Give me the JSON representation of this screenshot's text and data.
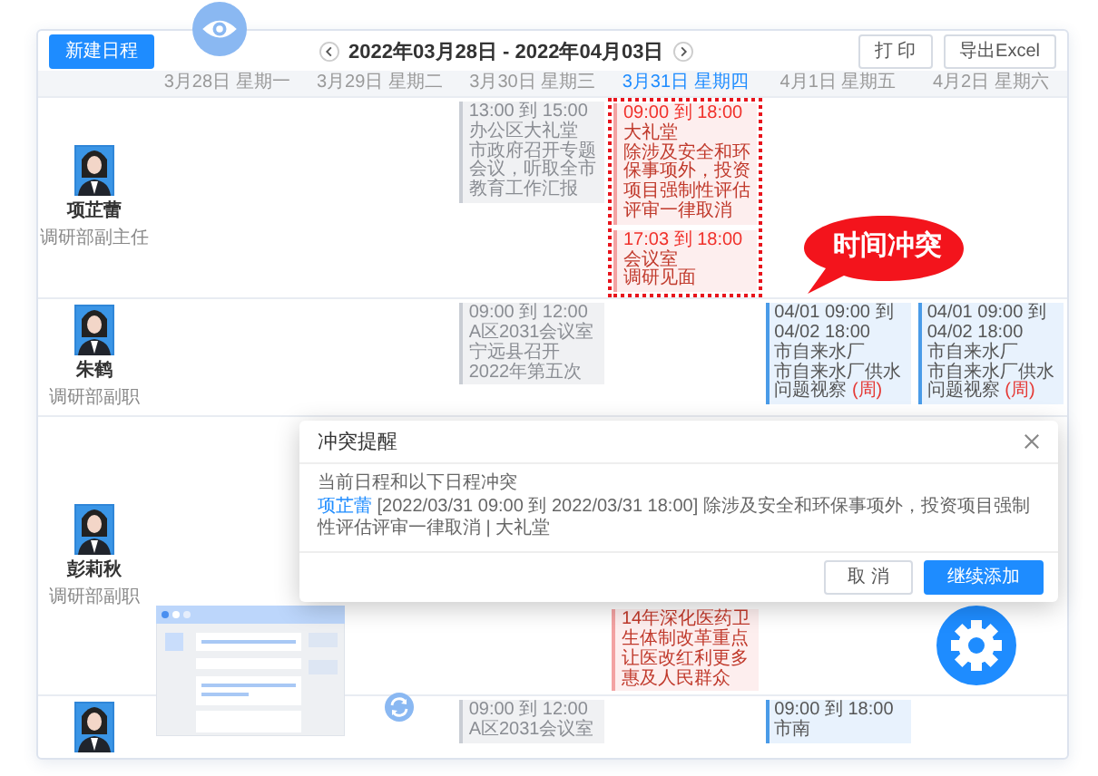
{
  "toolbar": {
    "new_button": "新建日程",
    "date_range": "2022年03月28日 - 2022年04月03日",
    "print_button": "打 印",
    "export_button": "导出Excel"
  },
  "days": [
    {
      "label": "3月28日 星期一",
      "selected": false
    },
    {
      "label": "3月29日 星期二",
      "selected": false
    },
    {
      "label": "3月30日 星期三",
      "selected": false
    },
    {
      "label": "3月31日 星期四",
      "selected": true
    },
    {
      "label": "4月1日 星期五",
      "selected": false
    },
    {
      "label": "4月2日 星期六",
      "selected": false
    }
  ],
  "people": [
    {
      "name": "项芷蕾",
      "title": "调研部副主任",
      "cells": [
        {
          "conflict": false
        },
        {
          "conflict": false
        },
        {
          "conflict": false,
          "events": [
            {
              "kind": "past",
              "time": "13:00 到 15:00",
              "place": "办公区大礼堂",
              "subject": "市政府召开专题会议，听取全市教育工作汇报"
            }
          ]
        },
        {
          "conflict": true,
          "events": [
            {
              "kind": "conflict",
              "time": "09:00 到 18:00",
              "place": "大礼堂",
              "subject": "除涉及安全和环保事项外，投资项目强制性评估评审一律取消"
            },
            {
              "kind": "conflict",
              "time": "17:03 到 18:00",
              "place": "会议室",
              "subject": "调研见面"
            }
          ]
        },
        {
          "conflict": false
        },
        {
          "conflict": false
        }
      ]
    },
    {
      "name": "朱鹤",
      "title": "调研部副职",
      "cells": [
        {
          "conflict": false
        },
        {
          "conflict": false
        },
        {
          "conflict": false,
          "events": [
            {
              "kind": "past",
              "time": "09:00 到 12:00",
              "place": "A区2031会议室",
              "subject": "宁远县召开2022年第五次"
            }
          ]
        },
        {
          "conflict": false
        },
        {
          "conflict": false,
          "events": [
            {
              "kind": "upcoming",
              "time": "04/01 09:00 到 04/02 18:00",
              "place": "市自来水厂",
              "subject": "市自来水厂供水问题视察",
              "tag": "(周)"
            }
          ]
        },
        {
          "conflict": false,
          "events": [
            {
              "kind": "upcoming",
              "time": "04/01 09:00 到 04/02 18:00",
              "place": "市自来水厂",
              "subject": "市自来水厂供水问题视察",
              "tag": "(周)"
            }
          ]
        }
      ]
    },
    {
      "name": "彭莉秋",
      "title": "调研部副职",
      "cells": [
        {
          "conflict": false
        },
        {
          "conflict": false
        },
        {
          "conflict": false
        },
        {
          "conflict": false,
          "events": [
            {
              "kind": "conflict",
              "subject": "14年深化医药卫生体制改革重点让医改红利更多惠及人民群众"
            }
          ]
        },
        {
          "conflict": false
        },
        {
          "conflict": false
        }
      ]
    },
    {
      "cells": [
        {
          "conflict": false
        },
        {
          "conflict": false
        },
        {
          "conflict": false,
          "events": [
            {
              "kind": "past",
              "time": "09:00 到 12:00",
              "place": "A区2031会议室"
            }
          ]
        },
        {
          "conflict": false
        },
        {
          "conflict": false,
          "events": [
            {
              "kind": "upcoming",
              "time": "09:00 到 18:00",
              "place": "市南"
            }
          ]
        },
        {
          "conflict": false
        }
      ]
    }
  ],
  "callout": "时间冲突",
  "dialog": {
    "title": "冲突提醒",
    "intro": "当前日程和以下日程冲突",
    "person": "项芷蕾",
    "detail": "[2022/03/31 09:00 到 2022/03/31 18:00] 除涉及安全和环保事项外，投资项目强制性评估评审一律取消 | 大礼堂",
    "buttons": [
      {
        "label": "取 消",
        "kind": "secondary"
      },
      {
        "label": "继续添加",
        "kind": "primary"
      }
    ]
  }
}
